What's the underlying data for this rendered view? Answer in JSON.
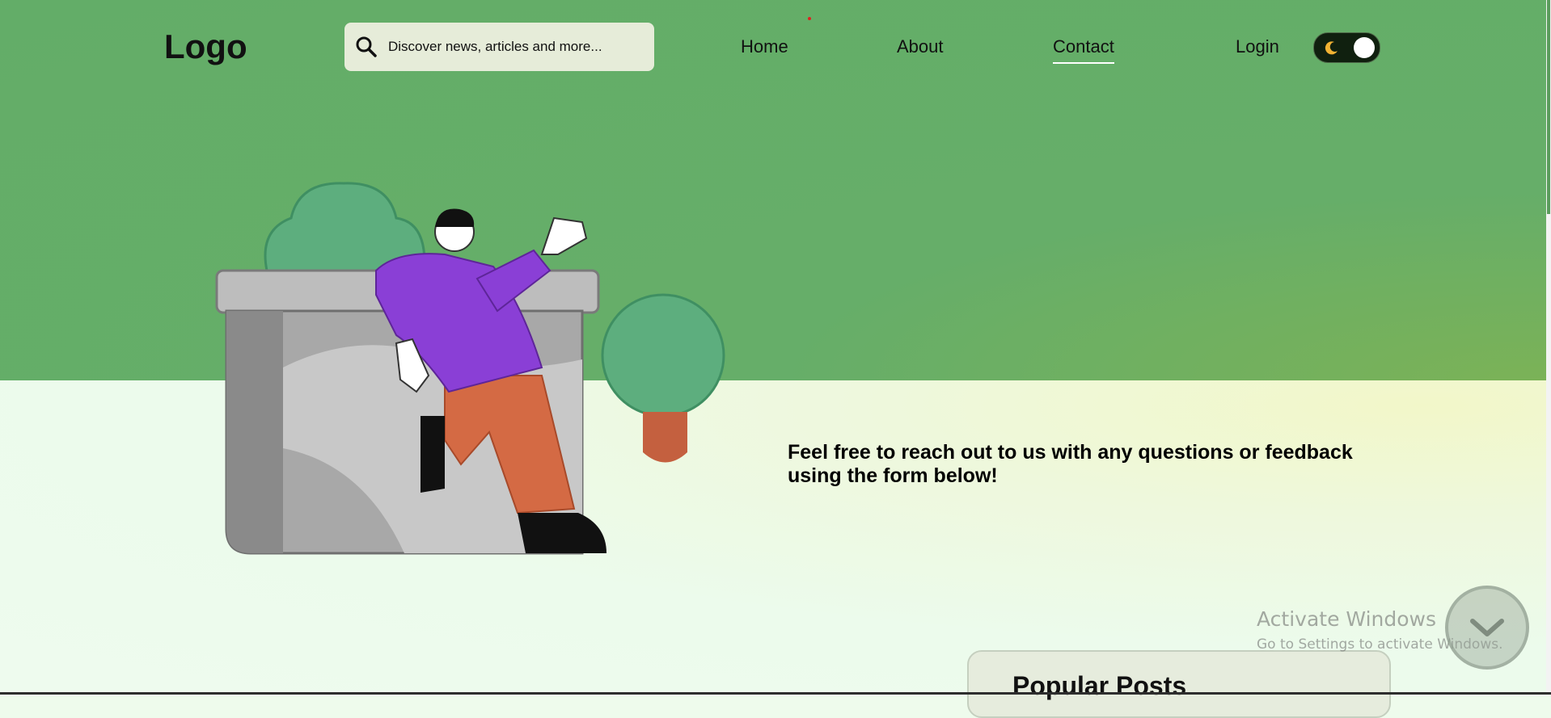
{
  "header": {
    "logo": "Logo",
    "search": {
      "placeholder": "Discover news, articles and more..."
    },
    "nav": [
      {
        "label": "Home"
      },
      {
        "label": "About"
      },
      {
        "label": "Contact",
        "active": true
      },
      {
        "label": "Login"
      }
    ],
    "theme_toggle": {
      "icon": "moon-icon",
      "state": "on"
    }
  },
  "hero": {
    "illustration": "person-leaning-on-planter-illustration",
    "tagline": "Feel free to reach out to us with any questions or feedback using the form below!"
  },
  "popular_posts": {
    "title": "Popular Posts"
  },
  "watermark": {
    "line1": "Activate Windows",
    "line2": "Go to Settings to activate Windows."
  },
  "scroll_button": {
    "icon": "chevron-down-icon"
  },
  "colors": {
    "hero_green": "#63ad68",
    "lower_background": "#eefbee",
    "toggle_bg": "#10200f",
    "accent_purple": "#8a3fd6",
    "accent_orange": "#d46a44"
  }
}
